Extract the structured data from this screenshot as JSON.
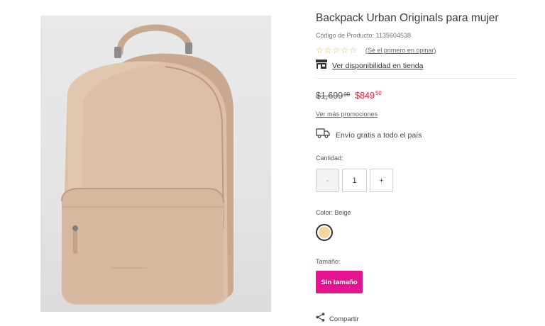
{
  "product": {
    "title": "Backpack Urban Originals para mujer",
    "code_text": "Código de Producto: 1135604538",
    "image_icon": "backpack-photo"
  },
  "rating": {
    "stars": [
      "☆",
      "☆",
      "☆",
      "☆",
      "☆"
    ],
    "link_text": "(Sé el primero en opinar)",
    "star_color": "#e8b93a"
  },
  "store": {
    "icon": "store-icon",
    "link_text": "Ver disponibilidad en tienda"
  },
  "price": {
    "old_main": "$1,699",
    "old_cents": "00",
    "new_main": "$849",
    "new_cents": "50",
    "sale_color": "#e4203c"
  },
  "promos_link": "Ver más promociones",
  "shipping": {
    "icon": "truck-icon",
    "text": "Envío gratis a todo el país"
  },
  "quantity": {
    "label": "Cantidad:",
    "minus": "-",
    "value": "1",
    "plus": "+"
  },
  "color": {
    "label": "Color: Beige",
    "swatch_hex": "#f5d59a"
  },
  "size": {
    "label": "Tamaño:",
    "button": "Sin tamaño",
    "accent": "#e5138f"
  },
  "share": {
    "icon": "share-icon",
    "text": "Compartir"
  }
}
